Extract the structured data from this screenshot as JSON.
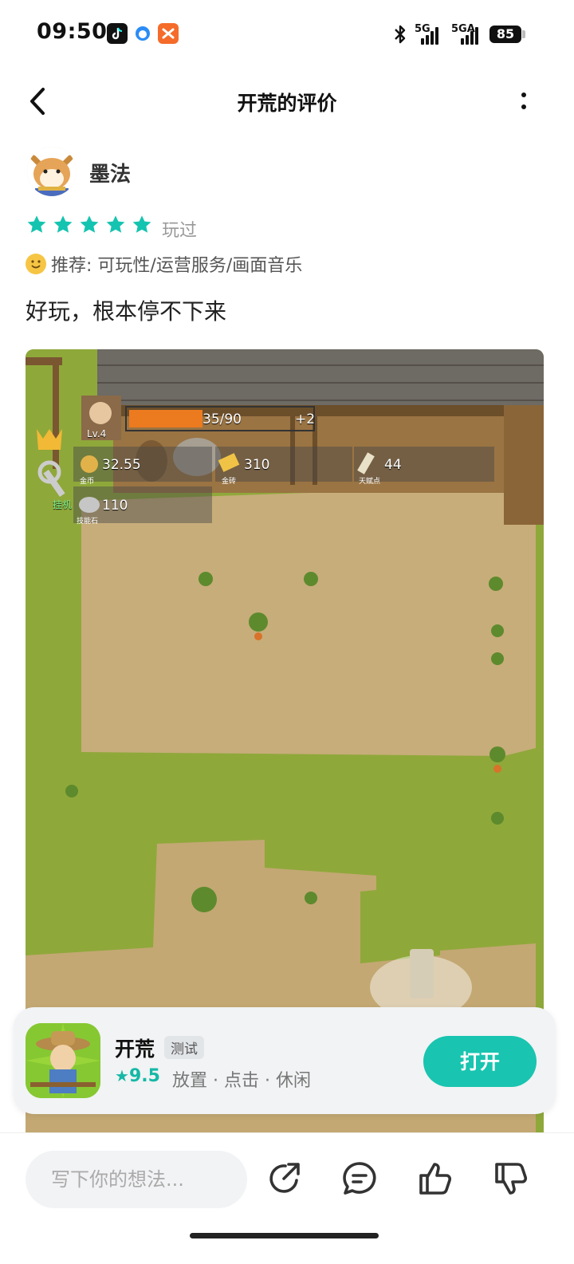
{
  "status_bar": {
    "time": "09:50",
    "network_1": "5G",
    "network_2": "5GA",
    "battery": "85"
  },
  "header": {
    "title": "开荒的评价"
  },
  "author": {
    "name": "墨法"
  },
  "rating": {
    "stars": 5,
    "max_stars": 5,
    "status": "玩过"
  },
  "recommend": {
    "text": "推荐: 可玩性/运营服务/画面音乐"
  },
  "review": {
    "text": "好玩，根本停不下来"
  },
  "game_screenshot": {
    "level": "Lv.4",
    "hp_bar_text": "35/90",
    "hp_fraction": 0.39,
    "bonus": "+2",
    "coins_value": "32.55",
    "coins_label": "金币",
    "gold_value": "310",
    "gold_label": "金砖",
    "talent_value": "44",
    "talent_label": "天赋点",
    "stone_value": "110",
    "stone_label": "技能石",
    "afk_label": "挂机"
  },
  "game_card": {
    "name": "开荒",
    "tag": "测试",
    "score": "9.5",
    "categories": "放置 · 点击 · 休闲",
    "open_label": "打开"
  },
  "bottom_bar": {
    "input_placeholder": "写下你的想法..."
  },
  "colors": {
    "accent": "#19c4b0",
    "star": "#15c4b0"
  }
}
